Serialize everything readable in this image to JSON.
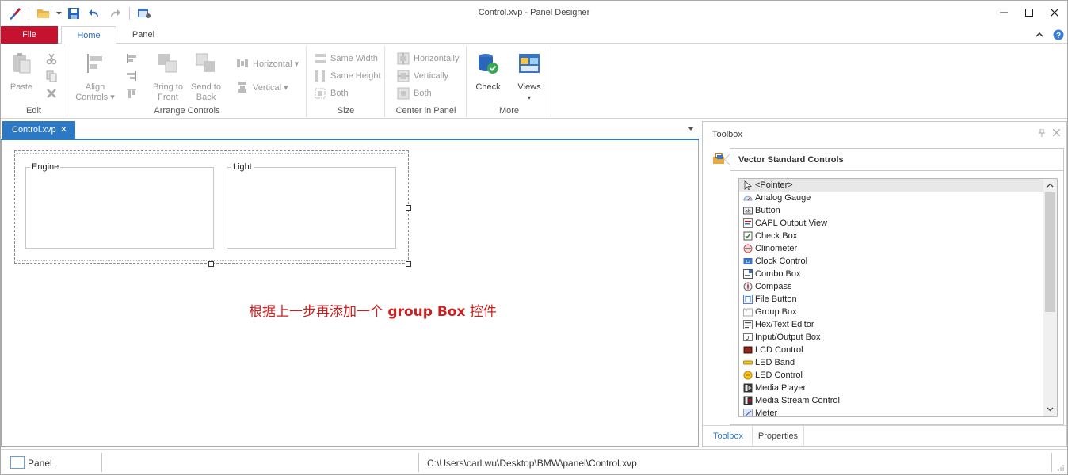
{
  "window": {
    "title": "Control.xvp - Panel Designer"
  },
  "ribbon_tabs": {
    "file": "File",
    "home": "Home",
    "panel": "Panel"
  },
  "ribbon": {
    "edit": {
      "paste": "Paste",
      "label": "Edit"
    },
    "arrange": {
      "align": "Align",
      "align2": "Controls ▾",
      "bring1": "Bring to",
      "bring2": "Front",
      "send1": "Send to",
      "send2": "Back",
      "horizontal": "Horizontal ▾",
      "vertical": "Vertical ▾",
      "label": "Arrange Controls"
    },
    "size": {
      "same_width": "Same Width",
      "same_height": "Same Height",
      "both": "Both",
      "label": "Size"
    },
    "center": {
      "horizontally": "Horizontally",
      "vertically": "Vertically",
      "both": "Both",
      "label": "Center in Panel"
    },
    "more": {
      "check": "Check",
      "views": "Views",
      "views_arrow": "▾",
      "label": "More"
    }
  },
  "document": {
    "tab_label": "Control.xvp",
    "tab_close": "✕",
    "groupbox_engine": "Engine",
    "groupbox_light": "Light",
    "annotation_cn1": "根据上一步再添加一个 ",
    "annotation_bold": "group Box",
    "annotation_cn2": " 控件"
  },
  "toolbox": {
    "title": "Toolbox",
    "section": "Vector Standard Controls",
    "items": [
      {
        "label": "<Pointer>",
        "icon": "pointer-icon"
      },
      {
        "label": "Analog Gauge",
        "icon": "analog-gauge-icon"
      },
      {
        "label": "Button",
        "icon": "button-icon"
      },
      {
        "label": "CAPL Output View",
        "icon": "capl-output-icon"
      },
      {
        "label": "Check Box",
        "icon": "checkbox-icon"
      },
      {
        "label": "Clinometer",
        "icon": "clinometer-icon"
      },
      {
        "label": "Clock Control",
        "icon": "clock-icon"
      },
      {
        "label": "Combo Box",
        "icon": "combobox-icon"
      },
      {
        "label": "Compass",
        "icon": "compass-icon"
      },
      {
        "label": "File Button",
        "icon": "file-button-icon"
      },
      {
        "label": "Group Box",
        "icon": "group-box-icon"
      },
      {
        "label": "Hex/Text Editor",
        "icon": "hex-editor-icon"
      },
      {
        "label": "Input/Output Box",
        "icon": "io-box-icon"
      },
      {
        "label": "LCD Control",
        "icon": "lcd-icon"
      },
      {
        "label": "LED Band",
        "icon": "led-band-icon"
      },
      {
        "label": "LED Control",
        "icon": "led-control-icon"
      },
      {
        "label": "Media Player",
        "icon": "media-player-icon"
      },
      {
        "label": "Media Stream Control",
        "icon": "media-stream-icon"
      },
      {
        "label": "Meter",
        "icon": "meter-icon"
      }
    ],
    "tab_toolbox": "Toolbox",
    "tab_properties": "Properties"
  },
  "statusbar": {
    "panel": "Panel",
    "path": "C:\\Users\\carl.wu\\Desktop\\BMW\\panel\\Control.xvp"
  },
  "colors": {
    "file_tab": "#c4122f",
    "accent_blue": "#2b78c5",
    "annotation_red": "#cc1f1f"
  }
}
